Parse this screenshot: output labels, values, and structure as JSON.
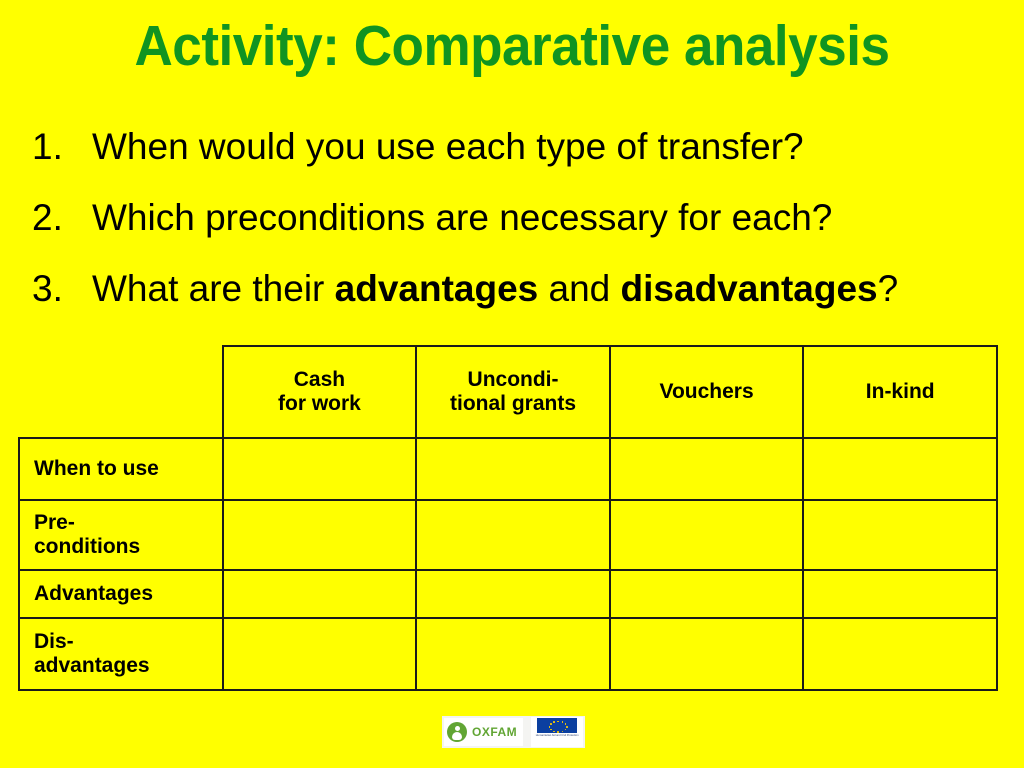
{
  "slide": {
    "background_color": "#FFFF00",
    "title": "Activity: Comparative analysis",
    "title_color": "#109421"
  },
  "questions": [
    {
      "number": "1.",
      "text_before": "When would you use each type of transfer?",
      "bold_1": "",
      "text_middle": "",
      "bold_2": "",
      "text_after": ""
    },
    {
      "number": "2.",
      "text_before": "Which preconditions are necessary for each?",
      "bold_1": "",
      "text_middle": "",
      "bold_2": "",
      "text_after": ""
    },
    {
      "number": "3.",
      "text_before": "What are their ",
      "bold_1": "advantages",
      "text_middle": " and ",
      "bold_2": "disadvantages",
      "text_after": "?"
    }
  ],
  "table": {
    "corner_label": "",
    "column_headers": [
      {
        "line1": "Cash",
        "line2": "for work"
      },
      {
        "line1": "Uncondi-",
        "line2": "tional grants"
      },
      {
        "line1": "Vouchers",
        "line2": ""
      },
      {
        "line1": "In-kind",
        "line2": ""
      }
    ],
    "rows": [
      {
        "label_line1": "When to use",
        "label_line2": "",
        "cells": [
          "",
          "",
          "",
          ""
        ]
      },
      {
        "label_line1": "Pre-",
        "label_line2": "conditions",
        "cells": [
          "",
          "",
          "",
          ""
        ]
      },
      {
        "label_line1": "Advantages",
        "label_line2": "",
        "cells": [
          "",
          "",
          "",
          ""
        ]
      },
      {
        "label_line1": "Dis-",
        "label_line2": "advantages",
        "cells": [
          "",
          "",
          "",
          ""
        ]
      }
    ]
  },
  "footer": {
    "oxfam_wordmark": "OXFAM",
    "eu_caption": "Humanitarian Aid and Civil Protection",
    "oxfam_color": "#61A534",
    "eu_flag_color": "#0b3fa0",
    "eu_star_color": "#FFCC00"
  }
}
